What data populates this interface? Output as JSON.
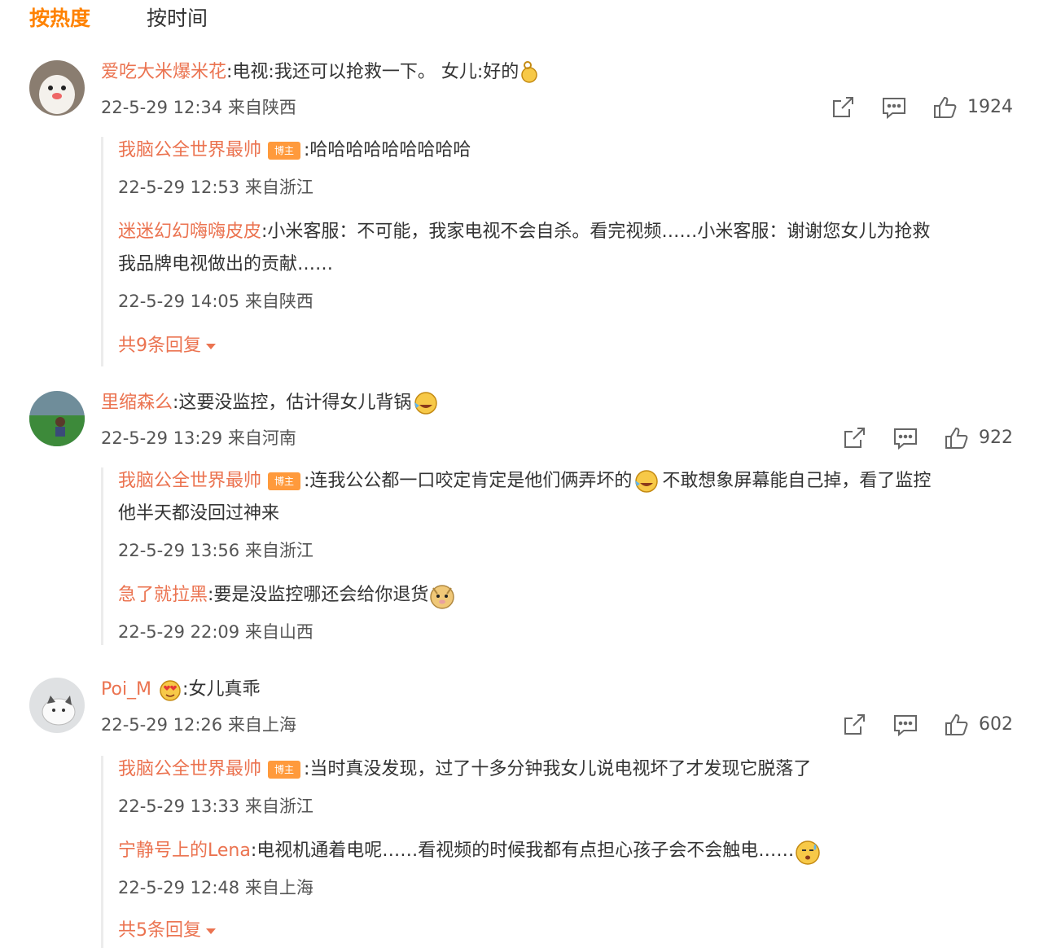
{
  "tabs": {
    "hot": "按热度",
    "time": "按时间"
  },
  "comments": [
    {
      "user": "爱吃大米爆米花",
      "text": ":电视:我还可以抢救一下。 女儿:好的",
      "meta": "22-5-29 12:34 来自陕西",
      "likes": "1924",
      "replies": [
        {
          "user": "我脑公全世界最帅",
          "badge": "博主",
          "text": ":哈哈哈哈哈哈哈哈哈",
          "meta": "22-5-29 12:53 来自浙江"
        },
        {
          "user": "迷迷幻幻嗨嗨皮皮",
          "text": ":小米客服：不可能，我家电视不会自杀。看完视频……小米客服：谢谢您女儿为抢救",
          "text2": "我品牌电视做出的贡献……",
          "meta": "22-5-29 14:05 来自陕西"
        }
      ],
      "more": "共9条回复"
    },
    {
      "user": "里缩森么",
      "text": ":这要没监控，估计得女儿背锅",
      "meta": "22-5-29 13:29 来自河南",
      "likes": "922",
      "replies": [
        {
          "user": "我脑公全世界最帅",
          "badge": "博主",
          "text": ":连我公公都一口咬定肯定是他们俩弄坏的",
          "text_b": " 不敢想象屏幕能自己掉，看了监控",
          "text2": "他半天都没回过神来",
          "meta": "22-5-29 13:56 来自浙江"
        },
        {
          "user": "急了就拉黑",
          "text": ":要是没监控哪还会给你退货",
          "meta": "22-5-29 22:09 来自山西"
        }
      ]
    },
    {
      "user": "Poi_M",
      "text": ":女儿真乖",
      "meta": "22-5-29 12:26 来自上海",
      "likes": "602",
      "replies": [
        {
          "user": "我脑公全世界最帅",
          "badge": "博主",
          "text": ":当时真没发现，过了十多分钟我女儿说电视坏了才发现它脱落了",
          "meta": "22-5-29 13:33 来自浙江"
        },
        {
          "user": "宁静号上的Lena",
          "text": ":电视机通着电呢……看视频的时候我都有点担心孩子会不会触电……",
          "meta": "22-5-29 12:48 来自上海"
        }
      ],
      "more": "共5条回复"
    }
  ],
  "icons": {
    "share": "share-icon",
    "comment": "comment-icon",
    "like": "thumbs-up-icon",
    "caret": "caret-down-icon"
  }
}
